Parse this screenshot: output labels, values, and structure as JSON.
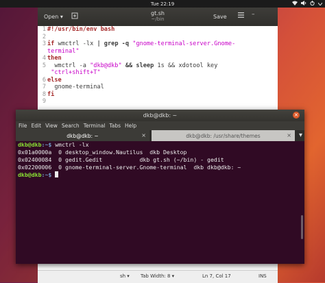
{
  "topbar": {
    "clock": "Tue 22:19"
  },
  "gedit": {
    "open_label": "Open ▾",
    "title": "gt.sh",
    "subtitle": "~/bin",
    "save_label": "Save",
    "menu_icon": "hamburger-icon",
    "gutter": [
      "1",
      "2",
      "3",
      "4",
      "5",
      "6",
      "7",
      "8",
      "9"
    ],
    "code": {
      "l1": "#!/usr/bin/env bash",
      "l3_if": "if",
      "l3_cmd": " wmctrl -lx ",
      "l3_pipe": "| grep -q ",
      "l3_str": "\"gnome-terminal-server.Gnome-",
      "l3b_str": "terminal\"",
      "l4": "then",
      "l5_cmd": "  wmctrl -a ",
      "l5_str": "\"dkb@dkb\"",
      "l5_and": " && ",
      "l5_sleep": "sleep",
      "l5_rest": " 1s && xdotool key",
      "l5b_str": "\"ctrl+shift+T\"",
      "l6": "else",
      "l7": "  gnome-terminal",
      "l8": "fi"
    },
    "status": {
      "lang": "sh ▾",
      "tab_width": "Tab Width: 8 ▾",
      "position": "Ln 7, Col 17",
      "mode": "INS"
    }
  },
  "terminal": {
    "title": "dkb@dkb: ~",
    "menu": [
      "File",
      "Edit",
      "View",
      "Search",
      "Terminal",
      "Tabs",
      "Help"
    ],
    "tabs": [
      {
        "label": "dkb@dkb: ~",
        "active": true
      },
      {
        "label": "dkb@dkb: /usr/share/themes",
        "active": false
      }
    ],
    "lines": [
      {
        "user": "dkb@dkb",
        "path": ":~$",
        "cmd": " wmctrl -lx"
      },
      {
        "text": "0x01a0000a  0 desktop_window.Nautilus  dkb Desktop"
      },
      {
        "text": "0x02400084  0 gedit.Gedit           dkb gt.sh (~/bin) - gedit"
      },
      {
        "text": "0x02200006  0 gnome-terminal-server.Gnome-terminal  dkb dkb@dkb: ~"
      },
      {
        "user": "dkb@dkb",
        "path": ":~$",
        "cmd": " "
      }
    ]
  }
}
